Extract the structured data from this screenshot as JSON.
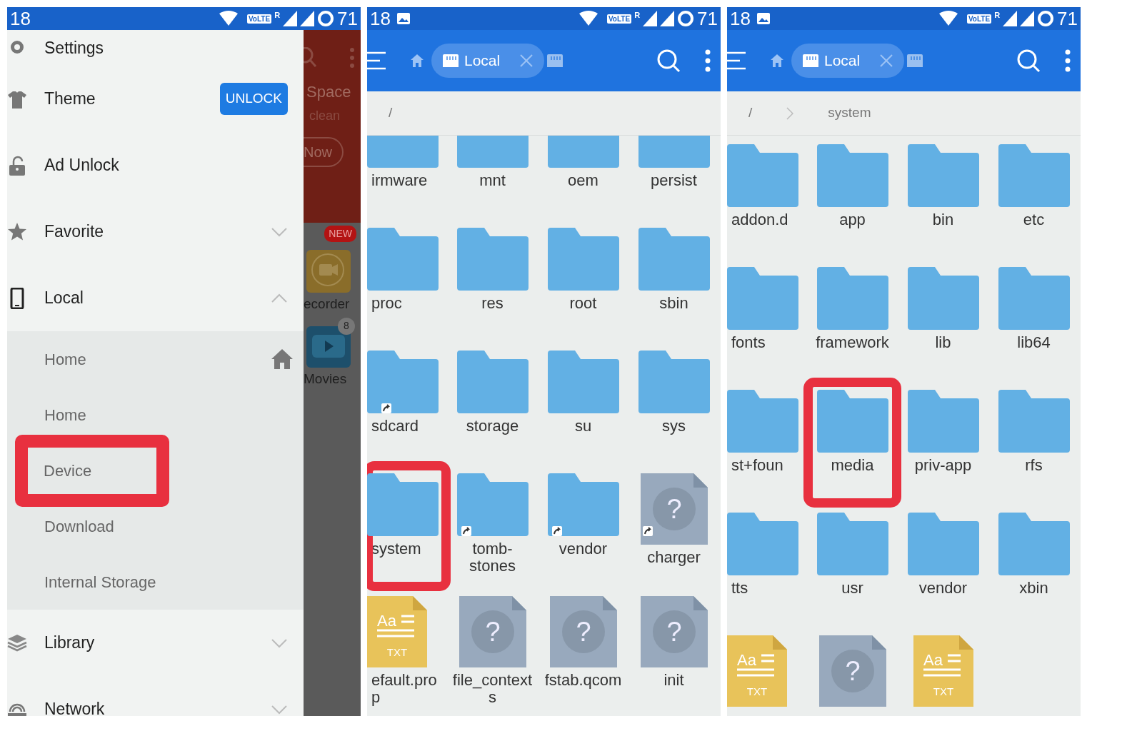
{
  "panels": [
    {
      "kind": "drawer",
      "status_bar": {
        "time": "18",
        "image_notification": false,
        "volte": "VoLTE",
        "roaming": "R",
        "battery": "71"
      },
      "drawer": {
        "items": [
          {
            "label": "Settings"
          },
          {
            "label": "Theme",
            "action": "UNLOCK"
          },
          {
            "label": "Ad Unlock"
          },
          {
            "label": "Favorite",
            "expanded": false
          },
          {
            "label": "Local",
            "expanded": true,
            "children": [
              {
                "label": "Home",
                "highlighted": false
              },
              {
                "label": "Home",
                "highlighted": false
              },
              {
                "label": "Device",
                "highlighted": true
              },
              {
                "label": "Download",
                "highlighted": false
              },
              {
                "label": "Internal Storage",
                "highlighted": false
              }
            ]
          },
          {
            "label": "Library",
            "expanded": false
          },
          {
            "label": "Network",
            "expanded": false
          }
        ]
      },
      "background_peek": {
        "banner_title": "Space",
        "banner_subtitle": "clean",
        "banner_button": "Now",
        "new_badge": "NEW",
        "app_label": "ecorder",
        "count_badge": "8",
        "movies_label": "Movies"
      }
    },
    {
      "kind": "browser",
      "status_bar": {
        "time": "18",
        "image_notification": true,
        "volte": "VoLTE",
        "roaming": "R",
        "battery": "71"
      },
      "tabs": [
        {
          "label": "Local",
          "selected": true
        },
        {
          "selected": false
        }
      ],
      "breadcrumbs": [
        "/"
      ],
      "scrolled": true,
      "items": [
        {
          "name": "irmware",
          "kind": "folder",
          "link": false,
          "highlighted": false
        },
        {
          "name": "mnt",
          "kind": "folder",
          "link": false,
          "highlighted": false
        },
        {
          "name": "oem",
          "kind": "folder",
          "link": false,
          "highlighted": false
        },
        {
          "name": "persist",
          "kind": "folder",
          "link": false,
          "highlighted": false
        },
        {
          "name": "proc",
          "kind": "folder",
          "link": false,
          "highlighted": false
        },
        {
          "name": "res",
          "kind": "folder",
          "link": false,
          "highlighted": false
        },
        {
          "name": "root",
          "kind": "folder",
          "link": false,
          "highlighted": false
        },
        {
          "name": "sbin",
          "kind": "folder",
          "link": false,
          "highlighted": false
        },
        {
          "name": "sdcard",
          "kind": "folder",
          "link": true,
          "highlighted": false
        },
        {
          "name": "storage",
          "kind": "folder",
          "link": false,
          "highlighted": false
        },
        {
          "name": "su",
          "kind": "folder",
          "link": false,
          "highlighted": false
        },
        {
          "name": "sys",
          "kind": "folder",
          "link": false,
          "highlighted": false
        },
        {
          "name": "system",
          "kind": "folder",
          "link": false,
          "highlighted": true
        },
        {
          "name": "tomb-\nstones",
          "kind": "folder",
          "link": true,
          "highlighted": false
        },
        {
          "name": "vendor",
          "kind": "folder",
          "link": true,
          "highlighted": false
        },
        {
          "name": "charger",
          "kind": "unknown",
          "glyph": "?",
          "link": true,
          "highlighted": false
        },
        {
          "name": "efault.pro\np",
          "kind": "text",
          "glyph": "Aa",
          "badge": "TXT",
          "link": false,
          "highlighted": false
        },
        {
          "name": "file_context\ns",
          "kind": "unknown",
          "glyph": "?",
          "link": false,
          "highlighted": false
        },
        {
          "name": "fstab.qcom",
          "kind": "unknown",
          "glyph": "?",
          "link": false,
          "highlighted": false
        },
        {
          "name": "init",
          "kind": "unknown",
          "glyph": "?",
          "link": false,
          "highlighted": false
        }
      ]
    },
    {
      "kind": "browser",
      "status_bar": {
        "time": "18",
        "image_notification": true,
        "volte": "VoLTE",
        "roaming": "R",
        "battery": "71"
      },
      "tabs": [
        {
          "label": "Local",
          "selected": true
        },
        {
          "selected": false
        }
      ],
      "breadcrumbs": [
        "/",
        "system"
      ],
      "scrolled": false,
      "items": [
        {
          "name": "addon.d",
          "kind": "folder",
          "link": false,
          "highlighted": false
        },
        {
          "name": "app",
          "kind": "folder",
          "link": false,
          "highlighted": false
        },
        {
          "name": "bin",
          "kind": "folder",
          "link": false,
          "highlighted": false
        },
        {
          "name": "etc",
          "kind": "folder",
          "link": false,
          "highlighted": false
        },
        {
          "name": "fonts",
          "kind": "folder",
          "link": false,
          "highlighted": false
        },
        {
          "name": "framework",
          "kind": "folder",
          "link": false,
          "highlighted": false
        },
        {
          "name": "lib",
          "kind": "folder",
          "link": false,
          "highlighted": false
        },
        {
          "name": "lib64",
          "kind": "folder",
          "link": false,
          "highlighted": false
        },
        {
          "name": "st+foun",
          "kind": "folder",
          "link": false,
          "highlighted": false
        },
        {
          "name": "media",
          "kind": "folder",
          "link": false,
          "highlighted": true
        },
        {
          "name": "priv-app",
          "kind": "folder",
          "link": false,
          "highlighted": false
        },
        {
          "name": "rfs",
          "kind": "folder",
          "link": false,
          "highlighted": false
        },
        {
          "name": "tts",
          "kind": "folder",
          "link": false,
          "highlighted": false
        },
        {
          "name": "usr",
          "kind": "folder",
          "link": false,
          "highlighted": false
        },
        {
          "name": "vendor",
          "kind": "folder",
          "link": false,
          "highlighted": false
        },
        {
          "name": "xbin",
          "kind": "folder",
          "link": false,
          "highlighted": false
        },
        {
          "kind": "text",
          "glyph": "Aa",
          "badge": "TXT",
          "link": false,
          "highlighted": false
        },
        {
          "kind": "unknown",
          "glyph": "?",
          "link": false,
          "highlighted": false
        },
        {
          "kind": "text",
          "glyph": "Aa",
          "badge": "TXT",
          "link": false,
          "highlighted": false
        }
      ]
    }
  ]
}
